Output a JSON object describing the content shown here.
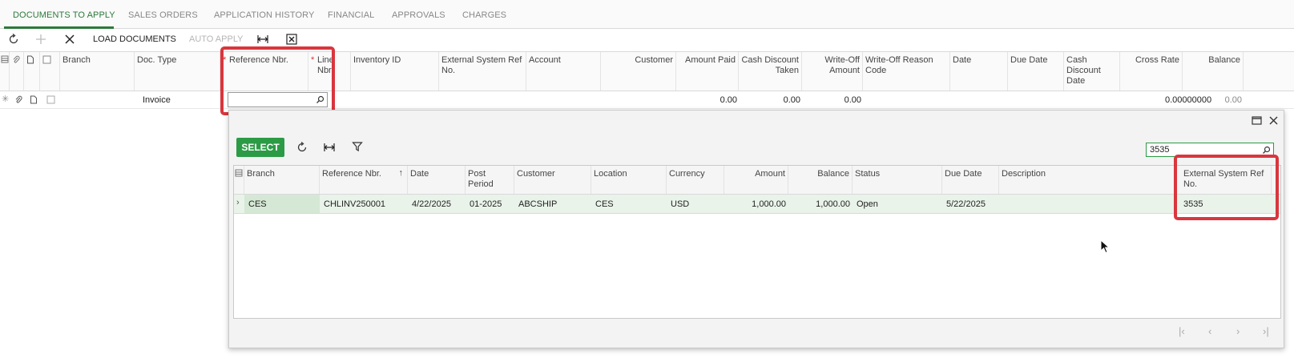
{
  "tabs": [
    {
      "label": "DOCUMENTS TO APPLY"
    },
    {
      "label": "SALES ORDERS"
    },
    {
      "label": "APPLICATION HISTORY"
    },
    {
      "label": "FINANCIAL"
    },
    {
      "label": "APPROVALS"
    },
    {
      "label": "CHARGES"
    }
  ],
  "toolbar": {
    "load_documents": "LOAD DOCUMENTS",
    "auto_apply": "AUTO APPLY",
    "icons": [
      "refresh-icon",
      "plus-icon",
      "close-icon",
      "fit-width-icon",
      "excel-icon"
    ]
  },
  "grid": {
    "headers": {
      "branch": "Branch",
      "doc_type": "Doc. Type",
      "ref_nbr": "Reference Nbr.",
      "line_nbr": "Line Nbr.",
      "inventory_id": "Inventory ID",
      "ext_ref": "External System Ref No.",
      "account": "Account",
      "customer": "Customer",
      "amount_paid": "Amount Paid",
      "cash_discount_taken": "Cash Discount Taken",
      "write_off_amount": "Write-Off Amount",
      "write_off_reason": "Write-Off Reason Code",
      "date": "Date",
      "due_date": "Due Date",
      "cash_discount_date": "Cash Discount Date",
      "cross_rate": "Cross Rate",
      "balance": "Balance"
    },
    "row": {
      "doc_type": "Invoice",
      "amount_paid": "0.00",
      "cash_discount_taken": "0.00",
      "write_off_amount": "0.00",
      "cross_rate": "0.00000000",
      "balance": "0.00"
    }
  },
  "lookup": {
    "select_label": "SELECT",
    "search_value": "3535",
    "headers": {
      "branch": "Branch",
      "ref_nbr": "Reference Nbr.",
      "sort_indicator": "↑",
      "date": "Date",
      "post_period": "Post Period",
      "customer": "Customer",
      "location": "Location",
      "currency": "Currency",
      "amount": "Amount",
      "balance": "Balance",
      "status": "Status",
      "due_date": "Due Date",
      "description": "Description",
      "ext_ref": "External System Ref No."
    },
    "row": {
      "branch": "CES",
      "ref_nbr": "CHLINV250001",
      "date": "4/22/2025",
      "post_period": "01-2025",
      "customer": "ABCSHIP",
      "location": "CES",
      "currency": "USD",
      "amount": "1,000.00",
      "balance": "1,000.00",
      "status": "Open",
      "due_date": "5/22/2025",
      "description": "",
      "ext_ref": "3535"
    }
  },
  "colors": {
    "accent_green": "#2b7a3a",
    "select_green": "#2b9b45",
    "highlight_red": "#d9363e",
    "row_selected": "#e9f3e9"
  }
}
